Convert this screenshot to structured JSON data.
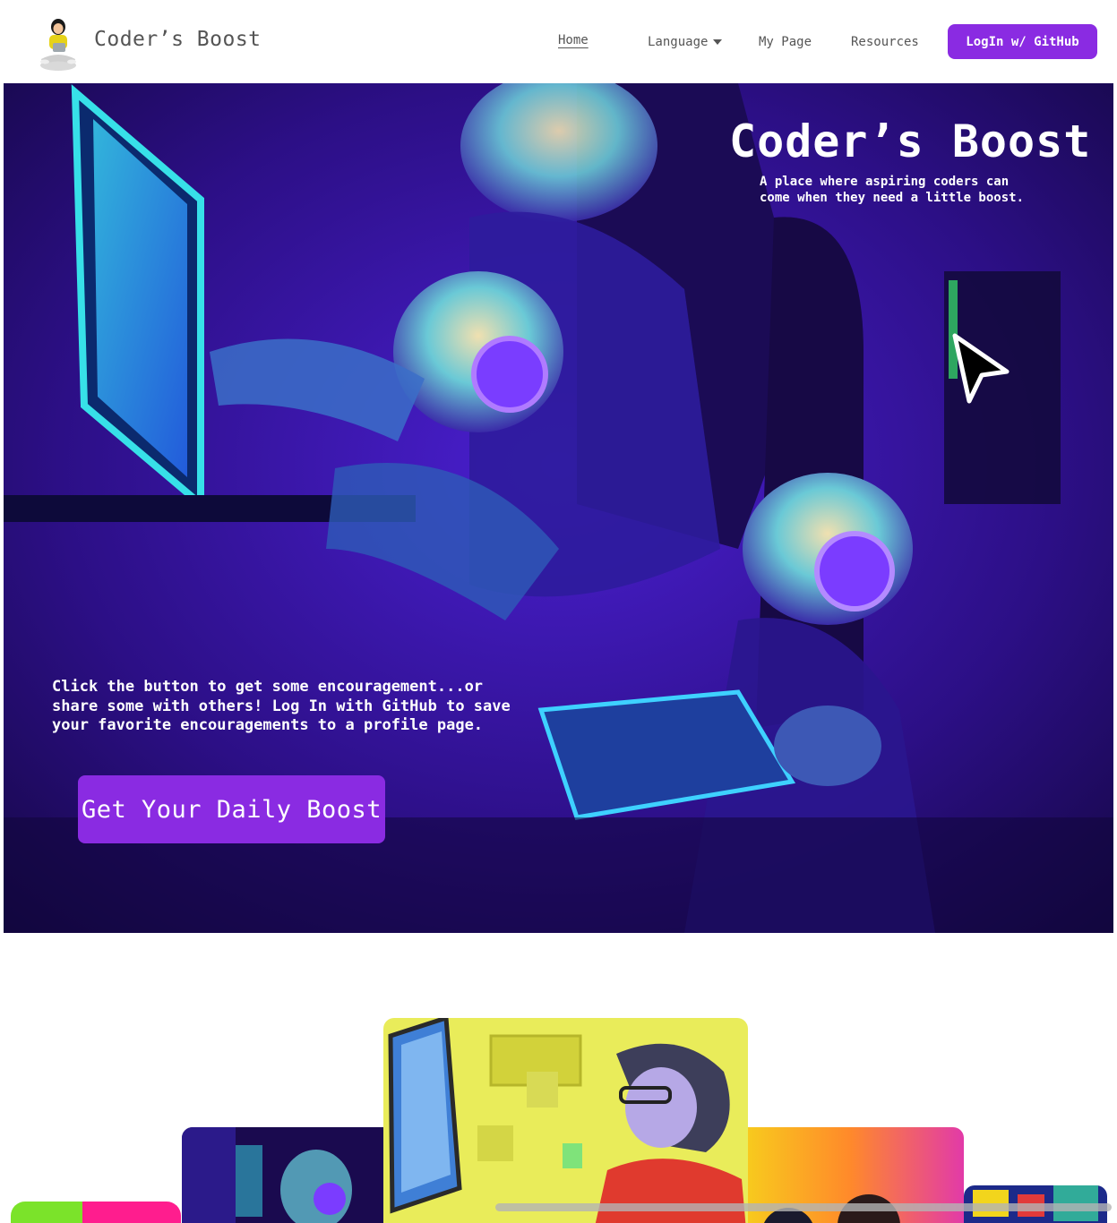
{
  "brand": {
    "name": "Coder’s Boost",
    "logo": "girl-with-laptop-logo"
  },
  "nav": {
    "home": "Home",
    "language": "Language",
    "my_page": "My Page",
    "resources": "Resources",
    "login": "LogIn w/ GitHub"
  },
  "hero": {
    "title": "Coder’s Boost",
    "subtitle": "A place where aspiring coders can come when they need a little boost.",
    "description": "Click the button to get some encouragement...or share some with others! Log In with GitHub to save your favorite encouragements to a profile page.",
    "cta": "Get Your Daily Boost"
  },
  "colors": {
    "accent": "#8a2be2",
    "hero_bg": "#2a0f7a",
    "nav_text": "#555555",
    "chip_green": "#7be32a",
    "chip_pink": "#ff1d8e"
  },
  "icons": {
    "caret": "caret-down-icon",
    "cursor": "cursor-arrow-icon"
  }
}
